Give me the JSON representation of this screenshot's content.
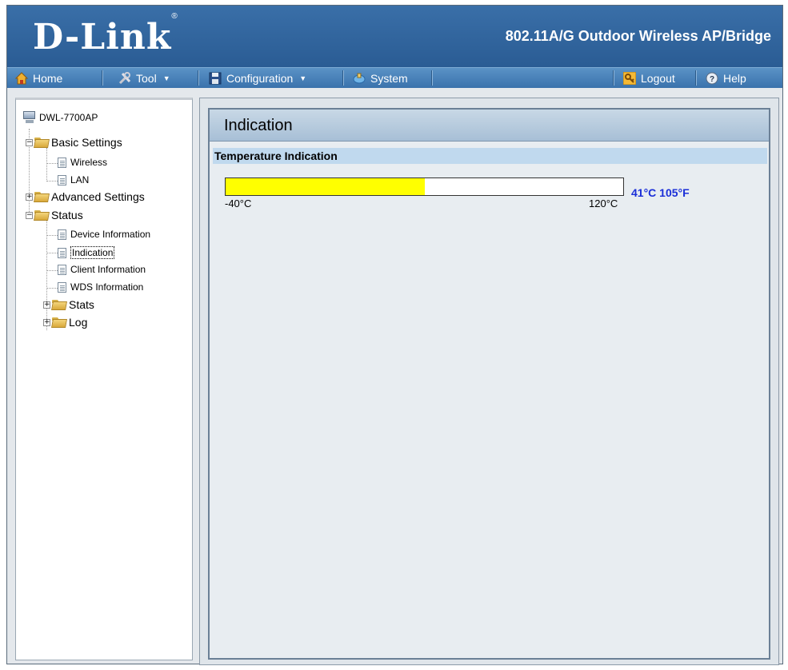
{
  "header": {
    "logo": "D-Link",
    "product": "802.11A/G Outdoor Wireless AP/Bridge"
  },
  "menu": {
    "home": "Home",
    "tool": "Tool",
    "configuration": "Configuration",
    "system": "System",
    "logout": "Logout",
    "help": "Help"
  },
  "tree": {
    "root": "DWL-7700AP",
    "basic_settings": "Basic Settings",
    "wireless": "Wireless",
    "lan": "LAN",
    "advanced_settings": "Advanced Settings",
    "status": "Status",
    "device_information": "Device Information",
    "indication": "Indication",
    "client_information": "Client Information",
    "wds_information": "WDS Information",
    "stats": "Stats",
    "log": "Log"
  },
  "content": {
    "title": "Indication",
    "section": "Temperature Indication",
    "temp_min": "-40°C",
    "temp_max": "120°C",
    "current": "41°C 105°F",
    "fill_fraction": 0.5
  },
  "colors": {
    "header_bg": "#2f64a0",
    "bar_fill": "#ffff00",
    "current_text": "#1a2ed8",
    "section_bg": "#c0d9ee"
  }
}
